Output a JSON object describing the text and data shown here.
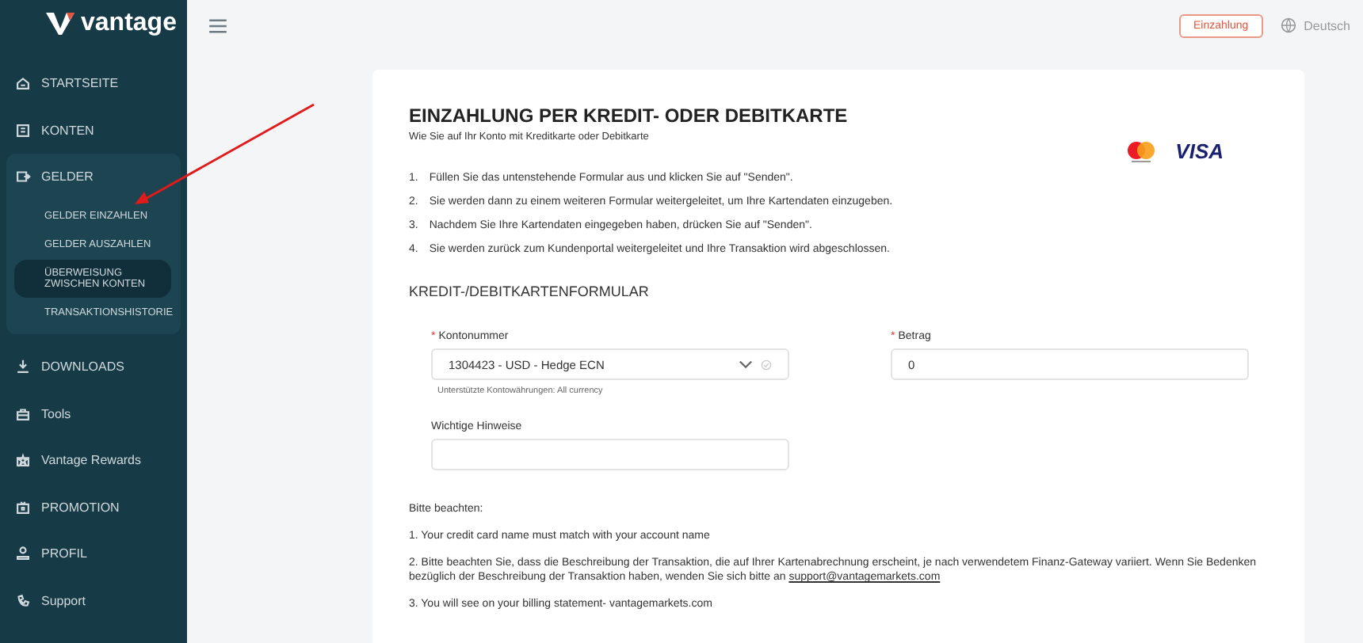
{
  "sidebar": {
    "logo": "vantage",
    "items": [
      {
        "label": "STARTSEITE",
        "selected": false
      },
      {
        "label": "KONTEN",
        "selected": false
      },
      {
        "label": "GELDER",
        "selected": false,
        "expanded": true,
        "children": [
          {
            "label": "GELDER EINZAHLEN",
            "selected": false
          },
          {
            "label": "GELDER AUSZAHLEN",
            "selected": false
          },
          {
            "label": "ÜBERWEISUNG ZWISCHEN KONTEN",
            "selected": true
          },
          {
            "label": "TRANSAKTIONSHISTORIE",
            "selected": false
          }
        ]
      },
      {
        "label": "DOWNLOADS",
        "selected": false
      },
      {
        "label": "Tools",
        "selected": false
      },
      {
        "label": "Vantage Rewards",
        "selected": false
      },
      {
        "label": "PROMOTION",
        "selected": false
      },
      {
        "label": "PROFIL",
        "selected": false
      },
      {
        "label": "Support",
        "selected": false
      }
    ]
  },
  "header": {
    "deposit_button": "Einzahlung",
    "language": "Deutsch"
  },
  "card": {
    "title": "EINZAHLUNG PER KREDIT- ODER DEBITKARTE",
    "subtitle": "Wie Sie auf Ihr Konto mit Kreditkarte oder Debitkarte",
    "visa": "VISA",
    "steps": [
      {
        "num": "1.",
        "text": "Füllen Sie das untenstehende Formular aus und klicken Sie auf \"Senden\"."
      },
      {
        "num": "2.",
        "text": "Sie werden dann zu einem weiteren Formular weitergeleitet, um Ihre Kartendaten einzugeben."
      },
      {
        "num": "3.",
        "text": "Nachdem Sie Ihre Kartendaten eingegeben haben, drücken Sie auf \"Senden\"."
      },
      {
        "num": "4.",
        "text": "Sie werden zurück zum Kundenportal weitergeleitet und Ihre Transaktion wird abgeschlossen."
      }
    ],
    "form_title": "KREDIT-/DEBITKARTENFORMULAR",
    "account": {
      "required_mark": "*",
      "label": "Kontonummer",
      "value": "1304423 - USD - Hedge ECN",
      "hint": "Unterstützte Kontowährungen: All currency"
    },
    "amount": {
      "required_mark": "*",
      "label": "Betrag",
      "value": "0"
    },
    "notes": {
      "label": "Wichtige Hinweise"
    },
    "remarks": [
      {
        "text": "Bitte beachten:"
      },
      {
        "text": "1. Your credit card name must match with your account name"
      },
      {
        "text": "2. Bitte beachten Sie, dass die Beschreibung der Transaktion, die auf Ihrer Kartenabrechnung erscheint, je nach verwendetem Finanz-Gateway variiert. Wenn Sie Bedenken bezüglich der Beschreibung der Transaktion haben, wenden Sie sich bitte an",
        "link": "support@vantagemarkets.com"
      },
      {
        "text": "3. You will see on your billing statement- vantagemarkets.com"
      }
    ]
  },
  "annotation": {
    "kind": "arrow"
  }
}
